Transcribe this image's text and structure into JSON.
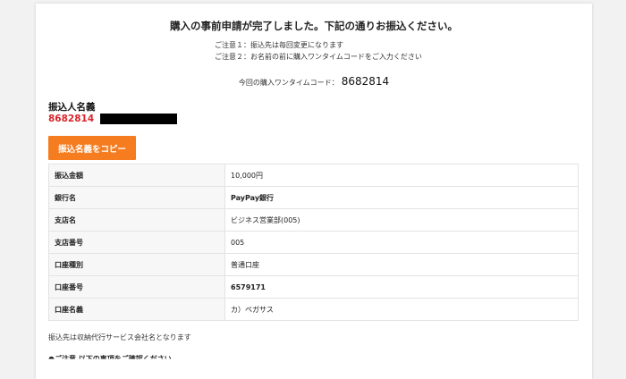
{
  "header": {
    "title": "購入の事前申請が完了しました。下記の通りお振込ください。",
    "note1": "ご注意１：振込先は毎回変更になります",
    "note2": "ご注意２：お名前の前に購入ワンタイムコードをご入力ください"
  },
  "onetime": {
    "label": "今回の購入ワンタイムコード：",
    "code": "8682814"
  },
  "payer": {
    "heading": "振込人名義",
    "code": "8682814"
  },
  "copy_button": "振込名義をコピー",
  "table": {
    "rows": [
      {
        "label": "振込金額",
        "value": "10,000円"
      },
      {
        "label": "銀行名",
        "value": "PayPay銀行"
      },
      {
        "label": "支店名",
        "value": "ビジネス営業部(005)"
      },
      {
        "label": "支店番号",
        "value": "005"
      },
      {
        "label": "口座種別",
        "value": "普通口座"
      },
      {
        "label": "口座番号",
        "value": "6579171"
      },
      {
        "label": "口座名義",
        "value": "カ）ペガサス"
      }
    ]
  },
  "footer": {
    "note": "振込先は収納代行サービス会社名となります",
    "cut_text": "●ご注意 以下の事項をご確認ください"
  },
  "colors": {
    "accent_orange": "#f57c1f",
    "code_red": "#d9262c"
  }
}
